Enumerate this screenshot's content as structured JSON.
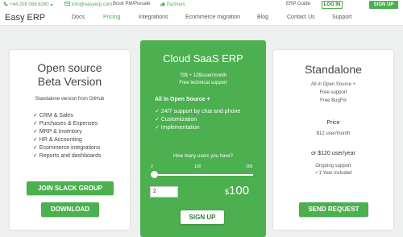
{
  "topbar": {
    "phone": "+44 208 068 8260",
    "phone_icon": "phone-icon",
    "email": "info@easyerp.com",
    "email_icon": "mail-icon",
    "book": "Book PM/Presale",
    "partners": "Partners",
    "partners_icon": "thumbs-up-icon",
    "erp_guide": "ERP Guide",
    "login": "LOG IN",
    "signup": "SIGN UP"
  },
  "nav": {
    "brand": "Easy ERP",
    "items": [
      {
        "label": "Docs"
      },
      {
        "label": "Pricing",
        "active": true
      },
      {
        "label": "Integrations"
      },
      {
        "label": "Ecommerce migration"
      },
      {
        "label": "Blog"
      },
      {
        "label": "Contact Us"
      },
      {
        "label": "Support"
      }
    ]
  },
  "open_source": {
    "title_line1": "Open source",
    "title_line2": "Beta Version",
    "subtitle": "Standalone version from GitHub",
    "features": [
      "✓ CRM & Sales",
      "✓ Purchases & Expenses",
      "✓ MRP & Inventory",
      "✓ HR & Accounting",
      "✓ Ecommerce integrations",
      "✓ Reports and dashboards"
    ],
    "join_button": "JOIN SLACK GROUP",
    "download_button": "DOWNLOAD"
  },
  "saas": {
    "title": "Cloud SaaS ERP",
    "price_line": "75$ + 12$/user/month",
    "support_line": "Free technical support",
    "all_in": "All in Open Source +",
    "features": [
      "✓ 24/7 support by chat and phone",
      "✓ Customization",
      "✓ Implementation"
    ],
    "users_question": "How many users you have?",
    "scale": [
      "2",
      "100",
      "200"
    ],
    "users_value": "2",
    "currency": "$",
    "total": "100",
    "slider_fraction": 0,
    "signup_button": "SIGN UP"
  },
  "standalone": {
    "title": "Standalone",
    "desc": [
      "All in Open Source +",
      "Free support",
      "Free BugFix"
    ],
    "price_label": "Price",
    "price_month": "$12 user/month",
    "price_year": "or $120 user/year",
    "ongoing": [
      "Ongoing support",
      "✓1 Year included"
    ],
    "send_button": "SEND REQUEST"
  },
  "colors": {
    "accent": "#4caf50",
    "background": "#eef0f0"
  }
}
